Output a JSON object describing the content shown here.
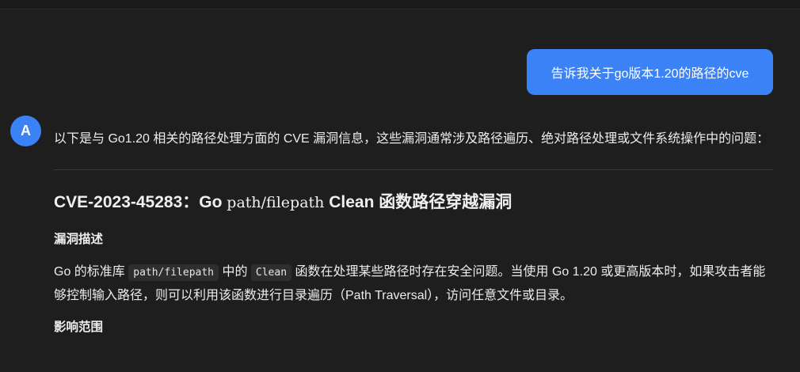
{
  "user_message": "告诉我关于go版本1.20的路径的cve",
  "assistant": {
    "avatar_letter": "A",
    "intro": "以下是与 Go1.20 相关的路径处理方面的 CVE 漏洞信息，这些漏洞通常涉及路径遍历、绝对路径处理或文件系统操作中的问题：",
    "cve_heading": {
      "prefix": "CVE-2023-45283：Go ",
      "code": "path/filepath",
      "suffix": " Clean 函数路径穿越漏洞"
    },
    "description_title": "漏洞描述",
    "description": {
      "part1": "Go 的标准库 ",
      "code1": "path/filepath",
      "part2": " 中的 ",
      "code2": "Clean",
      "part3": " 函数在处理某些路径时存在安全问题。当使用 Go 1.20 或更高版本时，如果攻击者能够控制输入路径，则可以利用该函数进行目录遍历（Path Traversal），访问任意文件或目录。"
    },
    "impact_title": "影响范围"
  }
}
